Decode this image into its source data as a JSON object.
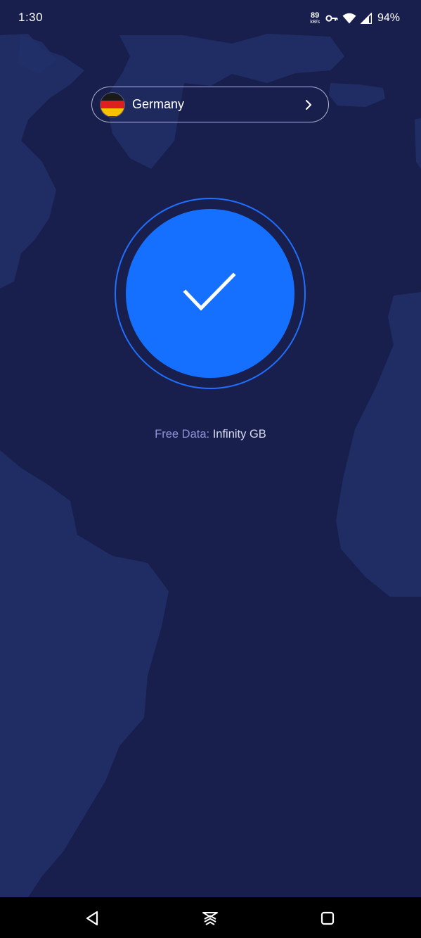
{
  "status_bar": {
    "time": "1:30",
    "net_speed_value": "89",
    "net_speed_unit": "kB/s",
    "battery": "94%",
    "icons": [
      "vpn-key-icon",
      "wifi-icon",
      "signal-icon"
    ]
  },
  "country_selector": {
    "country": "Germany",
    "flag_icon": "germany-flag-icon",
    "arrow_icon": "chevron-right-icon"
  },
  "connect_button": {
    "state_icon": "checkmark-icon",
    "color": "#1670ff",
    "ring_color": "#1f70ff"
  },
  "data": {
    "label": "Free Data:",
    "value": "Infinity GB"
  },
  "navigation": {
    "icons": [
      "back-icon",
      "home-icon",
      "recents-icon"
    ]
  },
  "colors": {
    "background": "#181f4d",
    "map_land": "#23306a"
  }
}
